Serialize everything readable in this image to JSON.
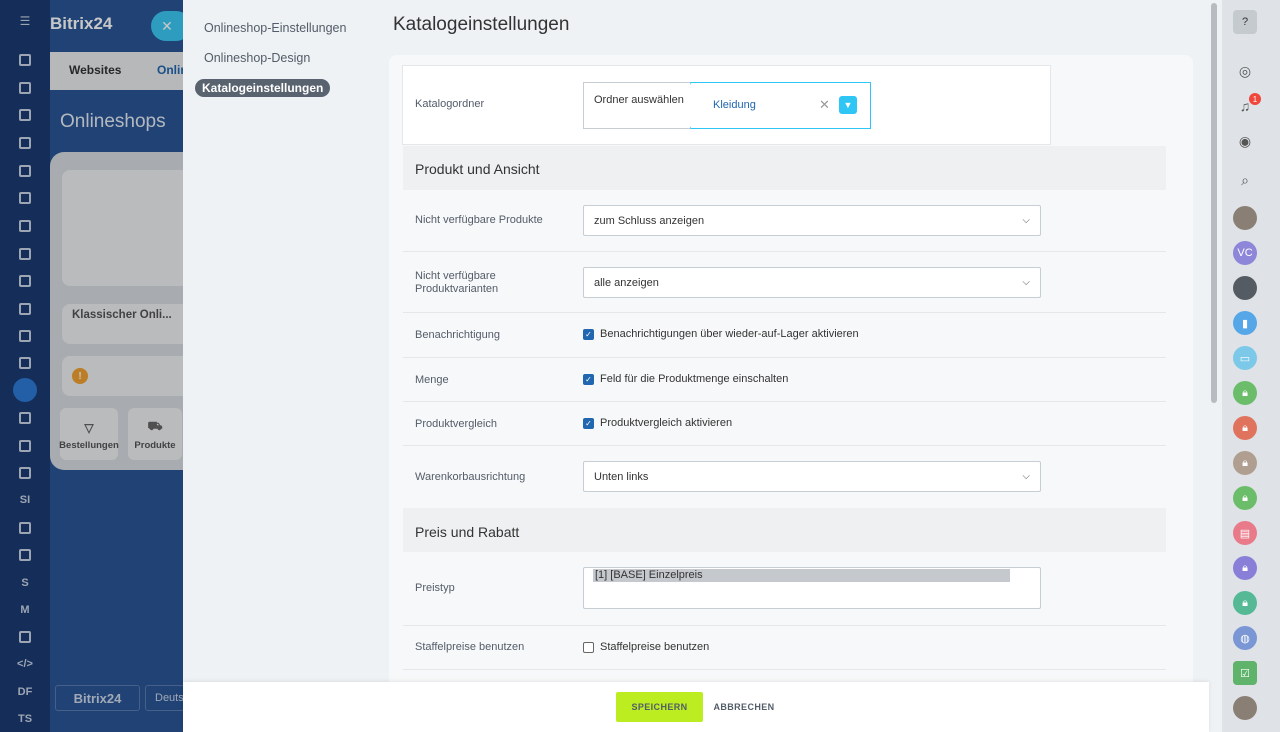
{
  "background": {
    "logo": "Bitrix24",
    "tabs": [
      "Websites",
      "Onlin"
    ],
    "title": "Onlineshops",
    "shop_title": "Klassischer Onli...",
    "buttons": [
      "Bestellungen",
      "Produkte"
    ],
    "footer_logo": "Bitrix24",
    "footer_lang": "Deuts",
    "rail_labels": [
      "SI",
      "S",
      "DF",
      "TS"
    ]
  },
  "side_menu": {
    "items": [
      {
        "label": "Onlineshop-Einstellungen"
      },
      {
        "label": "Onlineshop-Design"
      },
      {
        "label": "Katalogeinstellungen"
      }
    ]
  },
  "page_title": "Katalogeinstellungen",
  "catalog": {
    "label": "Katalogordner",
    "choose_label": "Ordner auswählen",
    "selected_value": "Kleidung"
  },
  "section_product": {
    "title": "Produkt und Ansicht",
    "fields": {
      "unavailable_products": {
        "label": "Nicht verfügbare Produkte",
        "value": "zum Schluss anzeigen"
      },
      "unavailable_variants": {
        "label": "Nicht verfügbare Produktvarianten",
        "value": "alle anzeigen"
      },
      "notification": {
        "label": "Benachrichtigung",
        "checkbox": "Benachrichtigungen über wieder-auf-Lager aktivieren",
        "checked": true
      },
      "quantity": {
        "label": "Menge",
        "checkbox": "Feld für die Produktmenge einschalten",
        "checked": true
      },
      "compare": {
        "label": "Produktvergleich",
        "checkbox": "Produktvergleich aktivieren",
        "checked": true
      },
      "cart_position": {
        "label": "Warenkorbausrichtung",
        "value": "Unten links"
      }
    }
  },
  "section_price": {
    "title": "Preis und Rabatt",
    "fields": {
      "price_type": {
        "label": "Preistyp",
        "options": [
          "[1] [BASE] Einzelpreis"
        ]
      },
      "tiered": {
        "label": "Staffelpreise benutzen",
        "checkbox": "Staffelpreise benutzen",
        "checked": false
      }
    }
  },
  "footer": {
    "save": "SPEICHERN",
    "cancel": "ABBRECHEN"
  },
  "right_bar": {
    "notification_count": "1",
    "avatar_initials": "VC"
  },
  "colors": {
    "accent": "#2fc6f6",
    "save_green": "#bbed21",
    "link_blue": "#2067b0"
  }
}
